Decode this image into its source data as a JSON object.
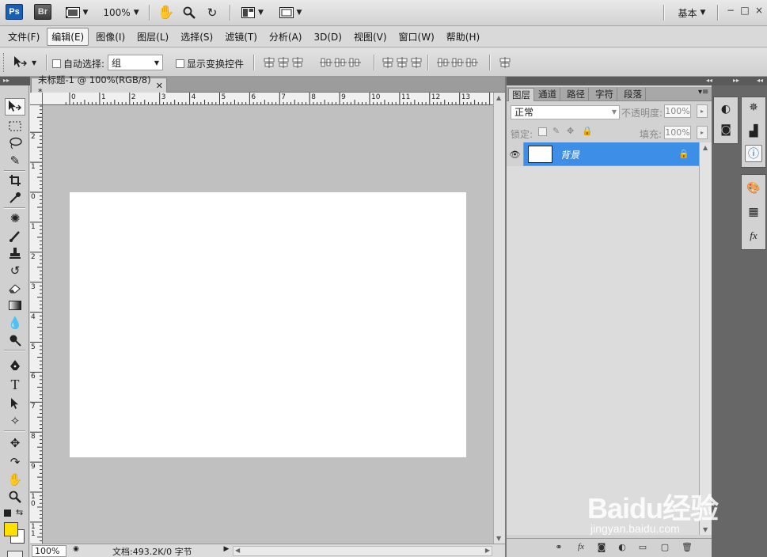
{
  "appbar": {
    "ps_logo": "Ps",
    "br_logo": "Br",
    "zoom": "100%",
    "workspace": "基本",
    "window_minimize": "−",
    "window_restore": "□",
    "window_close": "×"
  },
  "menubar": {
    "items": [
      "文件(F)",
      "编辑(E)",
      "图像(I)",
      "图层(L)",
      "选择(S)",
      "滤镜(T)",
      "分析(A)",
      "3D(D)",
      "视图(V)",
      "窗口(W)",
      "帮助(H)"
    ],
    "active_index": 1
  },
  "options": {
    "auto_select_label": "自动选择:",
    "auto_select_value": "组",
    "show_transform_label": "显示变换控件"
  },
  "document": {
    "tab_title": "未标题-1 @ 100%(RGB/8) *",
    "ruler_h": [
      "0",
      "1",
      "2",
      "3",
      "4",
      "5",
      "6",
      "7",
      "8",
      "9",
      "10",
      "11",
      "12",
      "13"
    ],
    "ruler_v": [
      "3",
      "2",
      "1",
      "0",
      "1",
      "2",
      "3",
      "4",
      "5",
      "6",
      "7",
      "8",
      "9",
      "10",
      "11",
      "12"
    ]
  },
  "status": {
    "zoom": "100%",
    "doc_info": "文档:493.2K/0 字节"
  },
  "layers_panel": {
    "tabs": [
      "图层",
      "通道",
      "路径",
      "字符",
      "段落"
    ],
    "blend_mode": "正常",
    "opacity_label": "不透明度:",
    "opacity_value": "100%",
    "lock_label": "锁定:",
    "fill_label": "填充:",
    "fill_value": "100%",
    "layers": [
      {
        "name": "背景",
        "locked": true,
        "visible": true
      }
    ]
  },
  "watermark": {
    "brand": "Baidu经验",
    "url": "jingyan.baidu.com"
  },
  "colors": {
    "foreground": "#ffe000",
    "background": "#ffffff",
    "selection": "#3d8ee6"
  }
}
